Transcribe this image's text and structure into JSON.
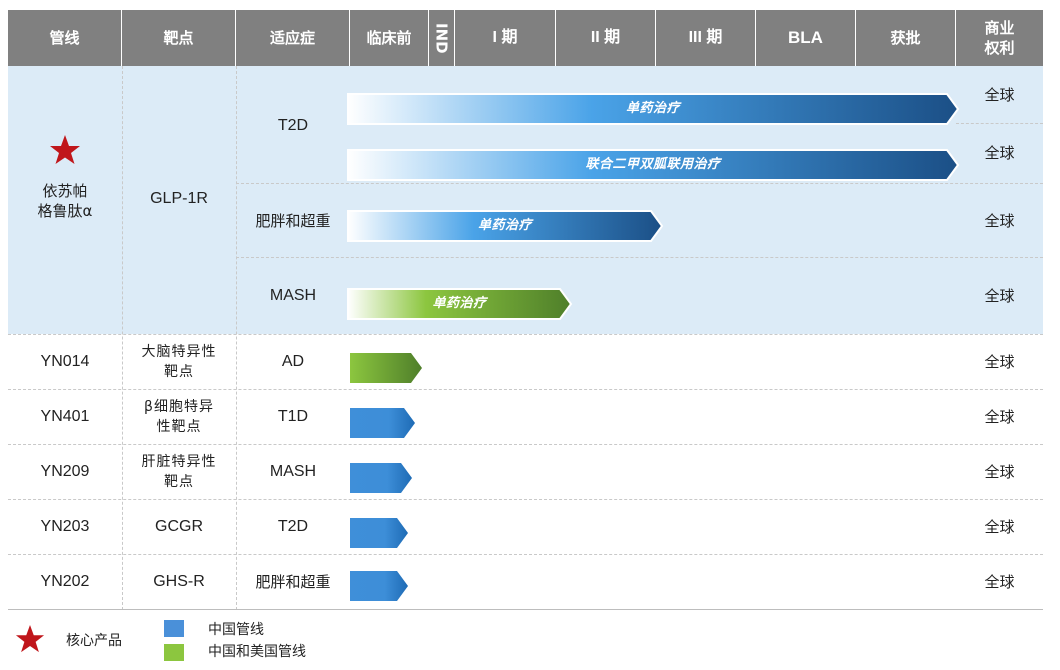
{
  "header": {
    "pipeline": "管线",
    "target": "靶点",
    "indication": "适应症",
    "preclinical": "临床前",
    "ind": "IND",
    "phase1": "I 期",
    "phase2": "II 期",
    "phase3": "III 期",
    "bla": "BLA",
    "approved": "获批",
    "rights": "商业\n权利"
  },
  "rows": [
    {
      "pipeline": "依苏帕\n格鲁肽α",
      "core": true,
      "target": "GLP-1R",
      "indications": [
        {
          "name": "T2D",
          "bars": [
            {
              "label": "单药治疗",
              "end_phase": "BLA",
              "kind": "china",
              "rights": "全球"
            },
            {
              "label": "联合二甲双胍联用治疗",
              "end_phase": "BLA",
              "kind": "china",
              "rights": "全球"
            }
          ]
        },
        {
          "name": "肥胖和超重",
          "bars": [
            {
              "label": "单药治疗",
              "end_phase": "II 期",
              "kind": "china",
              "rights": "全球"
            }
          ]
        },
        {
          "name": "MASH",
          "bars": [
            {
              "label": "单药治疗",
              "end_phase": "I 期",
              "kind": "china-us",
              "rights": "全球"
            }
          ]
        }
      ]
    },
    {
      "pipeline": "YN014",
      "target": "大脑特异性\n靶点",
      "indication": "AD",
      "kind": "china-us",
      "rights": "全球"
    },
    {
      "pipeline": "YN401",
      "target": "β细胞特异\n性靶点",
      "indication": "T1D",
      "kind": "china",
      "rights": "全球"
    },
    {
      "pipeline": "YN209",
      "target": "肝脏特异性\n靶点",
      "indication": "MASH",
      "kind": "china",
      "rights": "全球"
    },
    {
      "pipeline": "YN203",
      "target": "GCGR",
      "indication": "T2D",
      "kind": "china",
      "rights": "全球"
    },
    {
      "pipeline": "YN202",
      "target": "GHS-R",
      "indication": "肥胖和超重",
      "kind": "china",
      "rights": "全球"
    }
  ],
  "legend": {
    "core": "核心产品",
    "china": "中国管线",
    "china_us": "中国和美国管线"
  },
  "colors": {
    "header_bg": "#808080",
    "highlight_band": "#dcebf7",
    "china_blue": "#3f8fd9",
    "china_blue_dark": "#1b4f86",
    "china_us_green": "#8cc63f",
    "china_us_green_dark": "#4f7f2a",
    "star": "#c0161b"
  }
}
